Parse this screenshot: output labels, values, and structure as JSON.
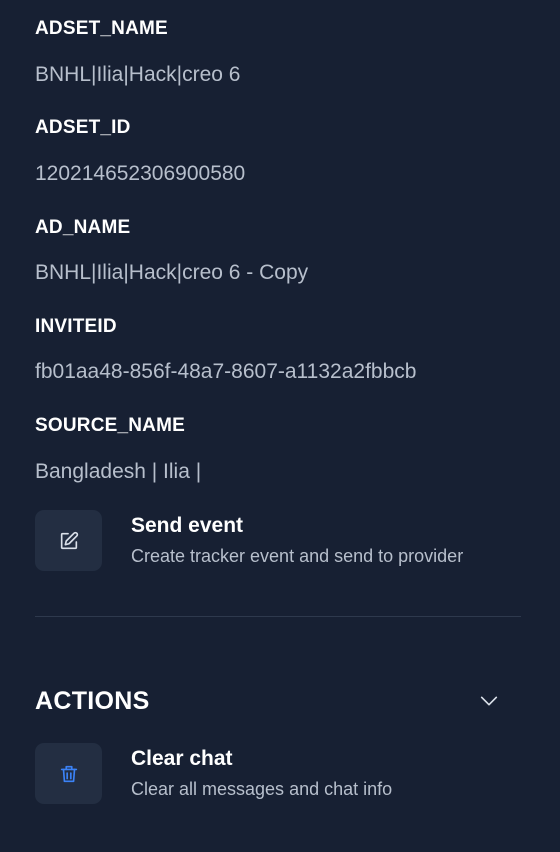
{
  "fields": [
    {
      "label": "ADSET_NAME",
      "value": "BNHL|Ilia|Hack|creo 6"
    },
    {
      "label": "ADSET_ID",
      "value": "120214652306900580"
    },
    {
      "label": "AD_NAME",
      "value": "BNHL|Ilia|Hack|creo 6 - Copy"
    },
    {
      "label": "INVITEID",
      "value": "fb01aa48-856f-48a7-8607-a1132a2fbbcb"
    },
    {
      "label": "SOURCE_NAME",
      "value": "Bangladesh | Ilia |"
    }
  ],
  "send_event": {
    "title": "Send event",
    "subtitle": "Create tracker event and send to provider",
    "icon": "edit-icon"
  },
  "actions_section": {
    "title": "ACTIONS",
    "toggle_icon": "chevron-down-icon",
    "items": [
      {
        "title": "Clear chat",
        "subtitle": "Clear all messages and chat info",
        "icon": "trash-icon",
        "icon_color": "#3b82f6"
      }
    ]
  },
  "colors": {
    "background": "#172033",
    "icon_box": "#232e42",
    "label": "#ffffff",
    "value": "#b7bfcc",
    "divider": "#2e394d"
  }
}
